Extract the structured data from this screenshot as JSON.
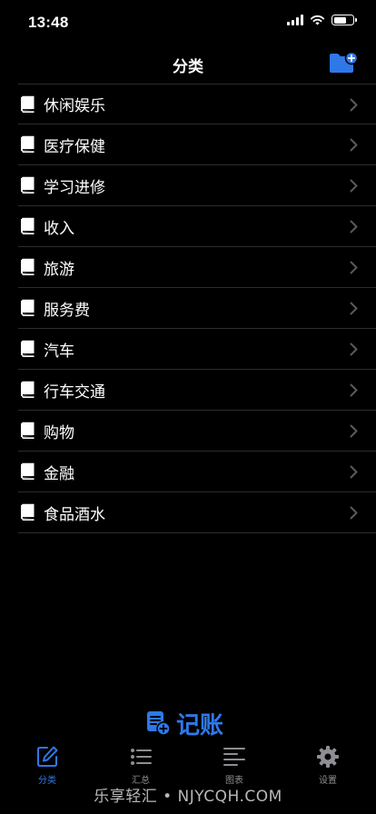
{
  "status": {
    "time": "13:48"
  },
  "nav": {
    "title": "分类"
  },
  "categories": [
    {
      "label": "休闲娱乐"
    },
    {
      "label": "医疗保健"
    },
    {
      "label": "学习进修"
    },
    {
      "label": "收入"
    },
    {
      "label": "旅游"
    },
    {
      "label": "服务费"
    },
    {
      "label": "汽车"
    },
    {
      "label": "行车交通"
    },
    {
      "label": "购物"
    },
    {
      "label": "金融"
    },
    {
      "label": "食品酒水"
    }
  ],
  "record_button": {
    "label": "记账"
  },
  "tabs": [
    {
      "label": "分类",
      "icon": "edit-square-icon",
      "active": true
    },
    {
      "label": "汇总",
      "icon": "list-icon",
      "active": false
    },
    {
      "label": "图表",
      "icon": "align-lines-icon",
      "active": false
    },
    {
      "label": "设置",
      "icon": "gear-icon",
      "active": false
    }
  ],
  "watermark": "乐享轻汇 • NJYCQH.COM",
  "colors": {
    "accent": "#2f78e8",
    "inactive": "#8e8e93",
    "background": "#000000",
    "separator": "#2c2c2e"
  }
}
